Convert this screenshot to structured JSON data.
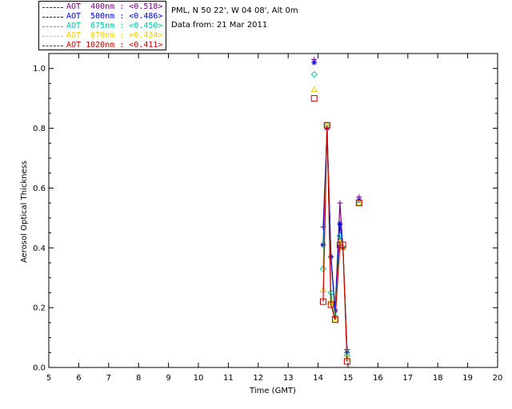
{
  "header": {
    "site": "PML, N 50 22', W 04 08', Alt 0m",
    "date_line": "Data from: 21 Mar 2011"
  },
  "legend": [
    {
      "label": "AOT  400nm : ",
      "value": "<0.518>",
      "color": "#7a0080"
    },
    {
      "label": "AOT  500nm : ",
      "value": "<0.486>",
      "color": "#0000d0"
    },
    {
      "label": "AOT  675nm : ",
      "value": "<0.450>",
      "color": "#00c8a0"
    },
    {
      "label": "AOT  870nm : ",
      "value": "<0.434>",
      "color": "#f0d000"
    },
    {
      "label": "AOT 1020nm : ",
      "value": "<0.411>",
      "color": "#c80000"
    }
  ],
  "chart_data": {
    "type": "line",
    "xlabel": "Time (GMT)",
    "ylabel": "Aerosol Optical Thickness",
    "xlim": [
      5,
      20
    ],
    "ylim": [
      0,
      1.05
    ],
    "xticks": [
      "5",
      "6",
      "7",
      "8",
      "9",
      "10",
      "11",
      "12",
      "13",
      "14",
      "15",
      "16",
      "17",
      "18",
      "19",
      "20"
    ],
    "yticks": [
      "0.0",
      "0.2",
      "0.4",
      "0.6",
      "0.8",
      "1.0"
    ],
    "series": [
      {
        "name": "AOT  400nm",
        "color": "#7a0080",
        "marker": "plus",
        "x": [
          13.87,
          14.17,
          14.3,
          14.43,
          14.57,
          14.73,
          14.83,
          14.97,
          15.37
        ],
        "y": [
          1.03,
          0.47,
          0.8,
          0.37,
          0.19,
          0.55,
          0.4,
          0.06,
          0.57
        ]
      },
      {
        "name": "AOT  500nm",
        "color": "#0000d0",
        "marker": "asterisk",
        "x": [
          13.87,
          14.17,
          14.3,
          14.43,
          14.57,
          14.73,
          14.83,
          14.97,
          15.37
        ],
        "y": [
          1.02,
          0.41,
          0.8,
          0.37,
          0.19,
          0.48,
          0.4,
          0.05,
          0.56
        ]
      },
      {
        "name": "AOT  675nm",
        "color": "#00c8a0",
        "marker": "diamond",
        "x": [
          13.87,
          14.17,
          14.3,
          14.43,
          14.57,
          14.73,
          14.83,
          14.97,
          15.37
        ],
        "y": [
          0.98,
          0.33,
          0.81,
          0.25,
          0.17,
          0.44,
          0.4,
          0.04,
          0.55
        ]
      },
      {
        "name": "AOT  870nm",
        "color": "#f0d000",
        "marker": "triangle",
        "x": [
          13.87,
          14.17,
          14.3,
          14.43,
          14.57,
          14.73,
          14.83,
          14.97,
          15.37
        ],
        "y": [
          0.93,
          0.26,
          0.81,
          0.22,
          0.16,
          0.42,
          0.4,
          0.03,
          0.55
        ]
      },
      {
        "name": "AOT 1020nm",
        "color": "#c80000",
        "marker": "square",
        "x": [
          13.87,
          14.17,
          14.3,
          14.43,
          14.57,
          14.73,
          14.83,
          14.97,
          15.37
        ],
        "y": [
          0.9,
          0.22,
          0.81,
          0.21,
          0.16,
          0.41,
          0.41,
          0.02,
          0.55
        ]
      }
    ]
  }
}
